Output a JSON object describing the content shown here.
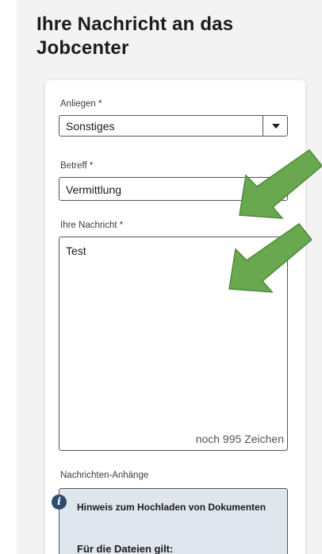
{
  "page_title": "Ihre Nachricht an das Jobcenter",
  "form": {
    "anliegen": {
      "label": "Anliegen *",
      "selected_value": "Sonstiges"
    },
    "betreff": {
      "label": "Betreff *",
      "value": "Vermittlung"
    },
    "nachricht": {
      "label": "Ihre Nachricht *",
      "value": "Test",
      "counter": "noch 995 Zeichen"
    },
    "anhaenge": {
      "label": "Nachrichten-Anhänge",
      "info_title": "Hinweis zum Hochladen von Dokumenten",
      "info_subtitle": "Für die Dateien gilt:"
    }
  },
  "colors": {
    "arrow_green": "#6aa84f",
    "info_box_bg": "#dfe6ee",
    "info_icon": "#2f4c6e"
  },
  "icons": {
    "select_caret": "chevron-down-icon",
    "info": "info-icon",
    "annotation_arrow": "arrow-icon"
  }
}
